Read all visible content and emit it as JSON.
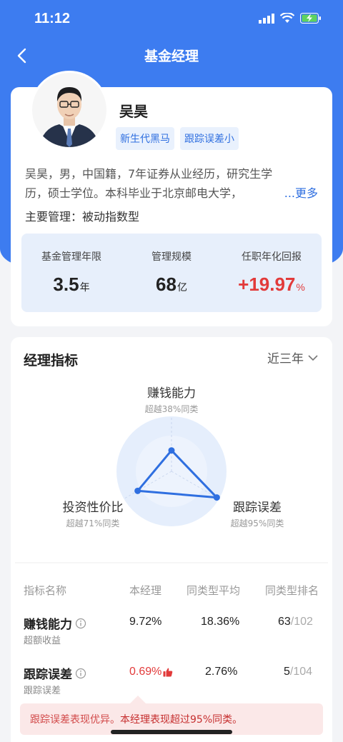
{
  "status_bar": {
    "time": "11:12"
  },
  "nav": {
    "title": "基金经理"
  },
  "profile": {
    "name": "吴昊",
    "tags": [
      "新生代黑马",
      "跟踪误差小"
    ],
    "bio_line1": "吴昊，男，中国籍，7年证券从业经历，研究生学",
    "bio_line2": "历，硕士学位。本科毕业于北京邮电大学，",
    "bio_more": "...更多",
    "main_manage": "主要管理：被动指数型",
    "stats": [
      {
        "label": "基金管理年限",
        "value": "3.5",
        "unit": "年"
      },
      {
        "label": "管理规模",
        "value": "68",
        "unit": "亿"
      },
      {
        "label": "任职年化回报",
        "value": "+19.97",
        "unit": "%"
      }
    ]
  },
  "indicators": {
    "title": "经理指标",
    "period": "近三年",
    "radar": [
      {
        "name": "赚钱能力",
        "sub": "超越38%同类",
        "percentile": 38
      },
      {
        "name": "跟踪误差",
        "sub": "超越95%同类",
        "percentile": 95
      },
      {
        "name": "投资性价比",
        "sub": "超越71%同类",
        "percentile": 71
      }
    ],
    "table_headers": [
      "指标名称",
      "本经理",
      "同类型平均",
      "同类型排名"
    ],
    "rows": [
      {
        "name": "赚钱能力",
        "sub": "超额收益",
        "manager": "9.72%",
        "avg": "18.36%",
        "rank": "63",
        "total": "/102"
      },
      {
        "name": "跟踪误差",
        "sub": "跟踪误差",
        "manager": "0.69%",
        "avg": "2.76%",
        "rank": "5",
        "total": "/104"
      }
    ],
    "tooltip_part1": "跟踪误差表现优异。",
    "tooltip_part2": "本经理表现超过95%同类。"
  },
  "colors": {
    "brand_blue": "#3d7cf0",
    "accent_red": "#e23a3a",
    "tag_bg": "#e9f1fd"
  }
}
